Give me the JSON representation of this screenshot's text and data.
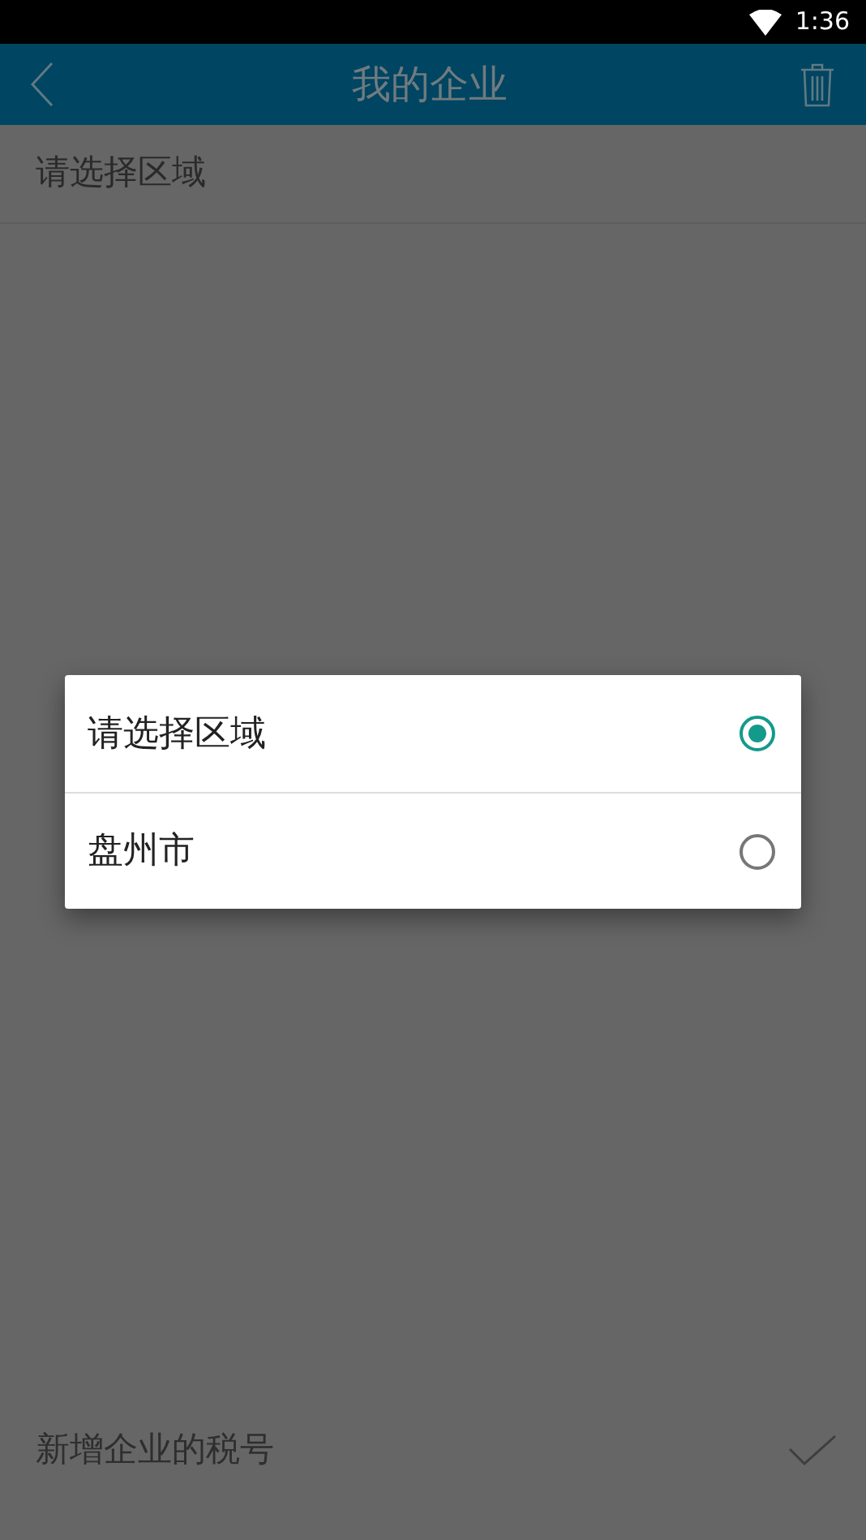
{
  "status_bar": {
    "time": "1:36"
  },
  "header": {
    "title": "我的企业"
  },
  "region_field": {
    "value": "请选择区域"
  },
  "tax_id_field": {
    "placeholder": "新增企业的税号"
  },
  "dialog": {
    "options": [
      {
        "label": "请选择区域",
        "selected": true
      },
      {
        "label": "盘州市",
        "selected": false
      }
    ]
  }
}
